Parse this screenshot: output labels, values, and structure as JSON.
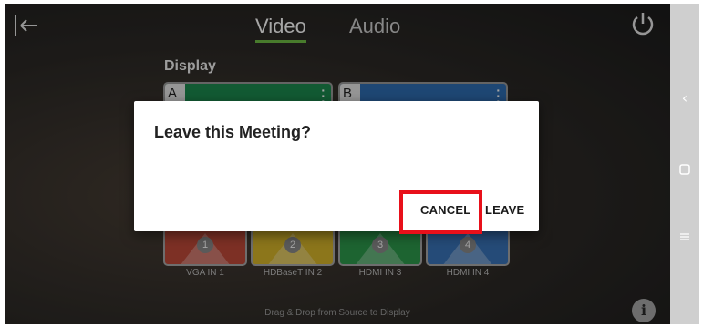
{
  "header": {
    "back_icon": "exit-arrow-icon",
    "tabs": [
      {
        "label": "Video",
        "active": true
      },
      {
        "label": "Audio",
        "active": false
      }
    ],
    "power_icon": "power-icon",
    "accent_color": "#6fbe44"
  },
  "display_section": {
    "label": "Display",
    "displays": [
      {
        "letter": "A",
        "color": "#1d8a4f",
        "menu_icon": "kebab-menu-icon"
      },
      {
        "letter": "B",
        "color": "#2f6db3",
        "menu_icon": "kebab-menu-icon"
      }
    ]
  },
  "sources": [
    {
      "number": "1",
      "label": "VGA IN 1",
      "color": "#c04a3a"
    },
    {
      "number": "2",
      "label": "HDBaseT IN 2",
      "color": "#d7b52a"
    },
    {
      "number": "3",
      "label": "HDMI IN 3",
      "color": "#2d9a4c"
    },
    {
      "number": "4",
      "label": "HDMI IN 4",
      "color": "#3a74b8"
    }
  ],
  "footer": {
    "hint": "Drag & Drop from Source to Display",
    "info_icon": "info-icon"
  },
  "dialog": {
    "title": "Leave this Meeting?",
    "cancel_label": "CANCEL",
    "leave_label": "LEAVE",
    "highlight_color": "#e8101a"
  },
  "android_nav": {
    "back_icon": "nav-back-icon",
    "home_icon": "nav-home-icon",
    "recents_icon": "nav-recents-icon"
  }
}
